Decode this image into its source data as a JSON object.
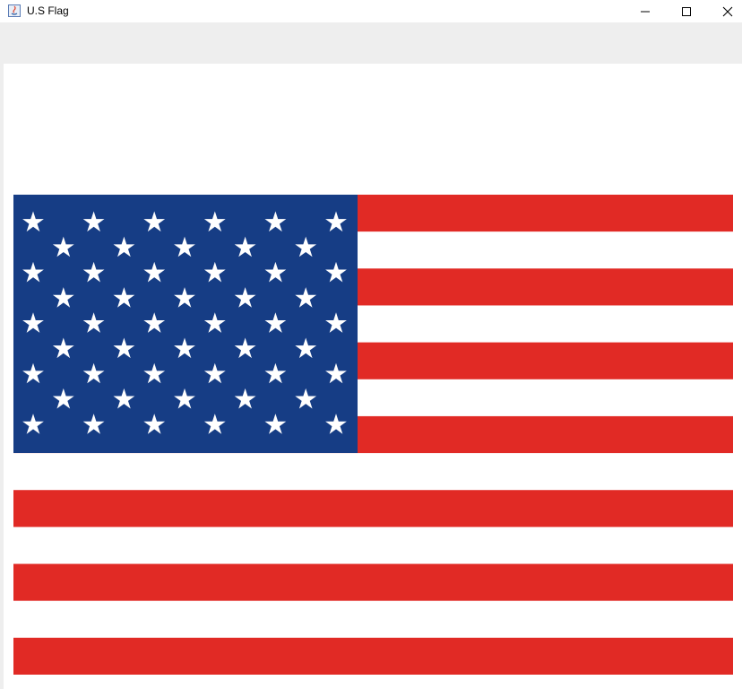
{
  "window": {
    "title": "U.S Flag",
    "icons": {
      "app": "java-app-icon",
      "minimize": "minimize-icon",
      "maximize": "maximize-icon",
      "close": "close-icon"
    }
  },
  "flag": {
    "stripe_count": 13,
    "star_count": 50,
    "colors": {
      "red": "#e12a25",
      "white": "#ffffff",
      "blue": "#163d85",
      "star": "#ffffff"
    }
  }
}
